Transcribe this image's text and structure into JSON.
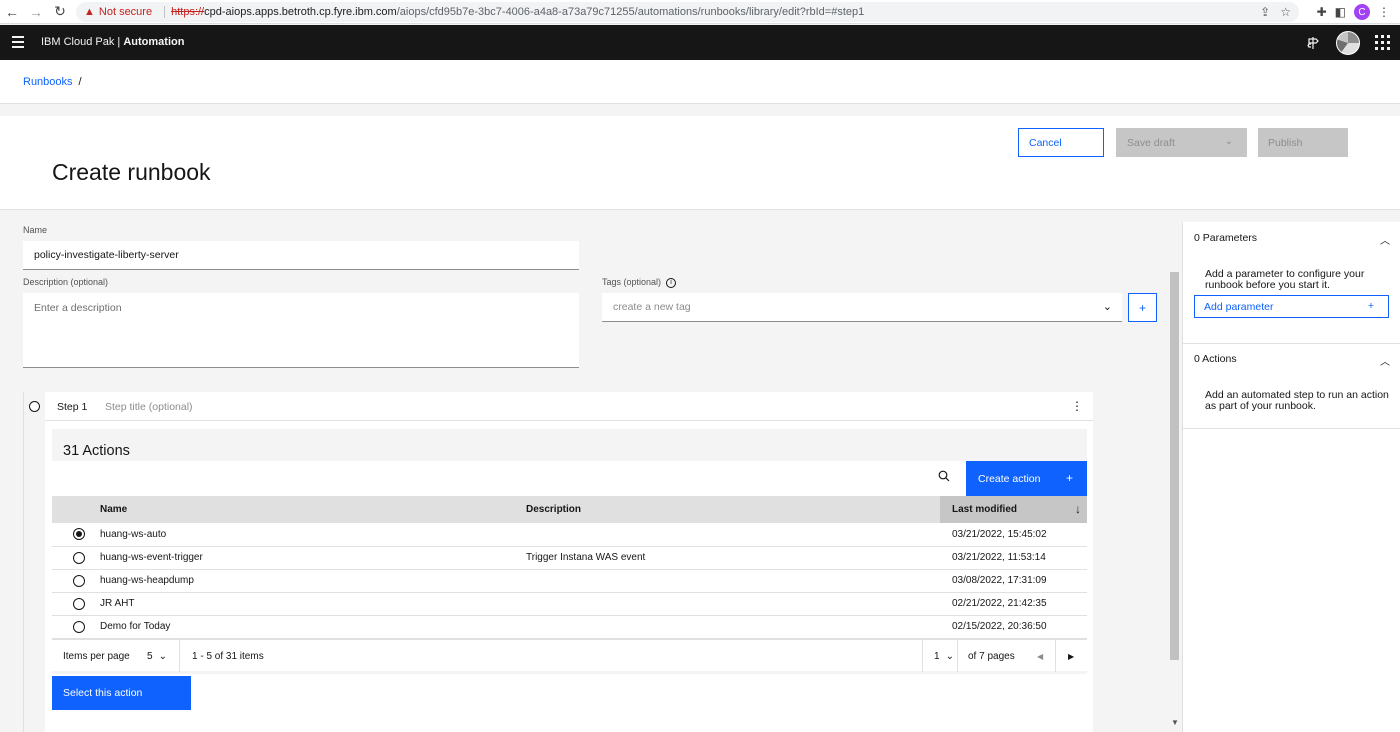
{
  "browser": {
    "security_label": "Not secure",
    "url_scheme": "https://",
    "url_host": "cpd-aiops.apps.betroth.cp.fyre.ibm.com",
    "url_path": "/aiops/cfd95b7e-3bc7-4006-a4a8-a73a79c71255/automations/runbooks/library/edit?rbId=#step1",
    "profile_initial": "C"
  },
  "header": {
    "brand_prefix": "IBM Cloud Pak | ",
    "brand_bold": "Automation"
  },
  "breadcrumb": {
    "link": "Runbooks",
    "separator": "/"
  },
  "page": {
    "title": "Create runbook",
    "cancel_label": "Cancel",
    "save_label": "Save draft",
    "publish_label": "Publish"
  },
  "form": {
    "name_label": "Name",
    "name_value": "policy-investigate-liberty-server",
    "desc_label": "Description (optional)",
    "desc_placeholder": "Enter a description",
    "tags_label": "Tags (optional)",
    "tags_placeholder": "create a new tag",
    "tags_add": "+"
  },
  "step": {
    "label": "Step 1",
    "title_placeholder": "Step title (optional)",
    "menu": "⋮"
  },
  "actions": {
    "title": "31 Actions",
    "create_label": "Create action",
    "create_plus": "+",
    "columns": [
      "Name",
      "Description",
      "Last modified"
    ],
    "rows": [
      {
        "name": "huang-ws-auto",
        "description": "",
        "modified": "03/21/2022, 15:45:02",
        "selected": true
      },
      {
        "name": "huang-ws-event-trigger",
        "description": "Trigger Instana WAS event",
        "modified": "03/21/2022, 11:53:14",
        "selected": false
      },
      {
        "name": "huang-ws-heapdump",
        "description": "",
        "modified": "03/08/2022, 17:31:09",
        "selected": false
      },
      {
        "name": "JR AHT",
        "description": "",
        "modified": "02/21/2022, 21:42:35",
        "selected": false
      },
      {
        "name": "Demo for Today",
        "description": "",
        "modified": "02/15/2022, 20:36:50",
        "selected": false
      }
    ],
    "pager": {
      "items_per_page_label": "Items per page",
      "items_per_page": "5",
      "range": "1 - 5 of 31 items",
      "page": "1",
      "of_pages": "of 7 pages"
    },
    "select_label": "Select this action"
  },
  "sidebar": {
    "params_title": "0 Parameters",
    "params_text": "Add a parameter to configure your runbook before you start it.",
    "add_param_label": "Add parameter",
    "add_param_plus": "+",
    "actions_title": "0 Actions",
    "actions_text": "Add an automated step to run an action as part of your runbook."
  },
  "colors": {
    "accent": "#0f62fe",
    "header_bg": "#161616",
    "disabled": "#c6c6c6"
  }
}
